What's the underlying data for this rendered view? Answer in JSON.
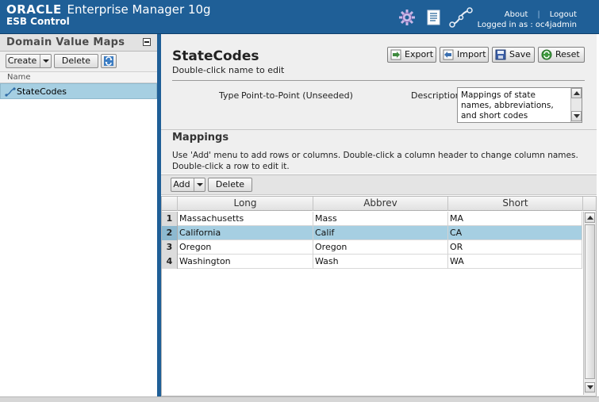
{
  "header": {
    "brand_oracle": "ORACLE",
    "brand_product": "Enterprise Manager 10g",
    "brand_subtitle": "ESB Control",
    "about_link": "About",
    "logout_link": "Logout",
    "logged_in_text": "Logged in as : oc4jadmin",
    "icons": [
      "gear-icon",
      "document-icon",
      "connection-icon"
    ]
  },
  "left_panel": {
    "title": "Domain Value Maps",
    "create_label": "Create",
    "delete_label": "Delete",
    "list_header": "Name",
    "items": [
      {
        "label": "StateCodes",
        "icon": "map-connector-icon"
      }
    ]
  },
  "detail": {
    "title": "StateCodes",
    "subtitle": "Double-click name to edit",
    "export_label": "Export",
    "import_label": "Import",
    "save_label": "Save",
    "reset_label": "Reset",
    "type_label": "Type",
    "type_value": "Point-to-Point (Unseeded)",
    "description_label": "Description",
    "description_value": "Mappings of state names, abbreviations, and short codes"
  },
  "mappings": {
    "title": "Mappings",
    "help": "Use 'Add' menu to add rows or columns. Double-click a column header to change column names. Double-click a row to edit it.",
    "add_label": "Add",
    "delete_label": "Delete",
    "columns": [
      "Long",
      "Abbrev",
      "Short"
    ],
    "rows": [
      {
        "num": "1",
        "long": "Massachusetts",
        "abbrev": "Mass",
        "short": "MA"
      },
      {
        "num": "2",
        "long": "California",
        "abbrev": "Calif",
        "short": "CA"
      },
      {
        "num": "3",
        "long": "Oregon",
        "abbrev": "Oregon",
        "short": "OR"
      },
      {
        "num": "4",
        "long": "Washington",
        "abbrev": "Wash",
        "short": "WA"
      }
    ],
    "selected_row": 2
  },
  "colors": {
    "header_blue": "#1f5f97",
    "selection_blue": "#a6cfe2"
  }
}
